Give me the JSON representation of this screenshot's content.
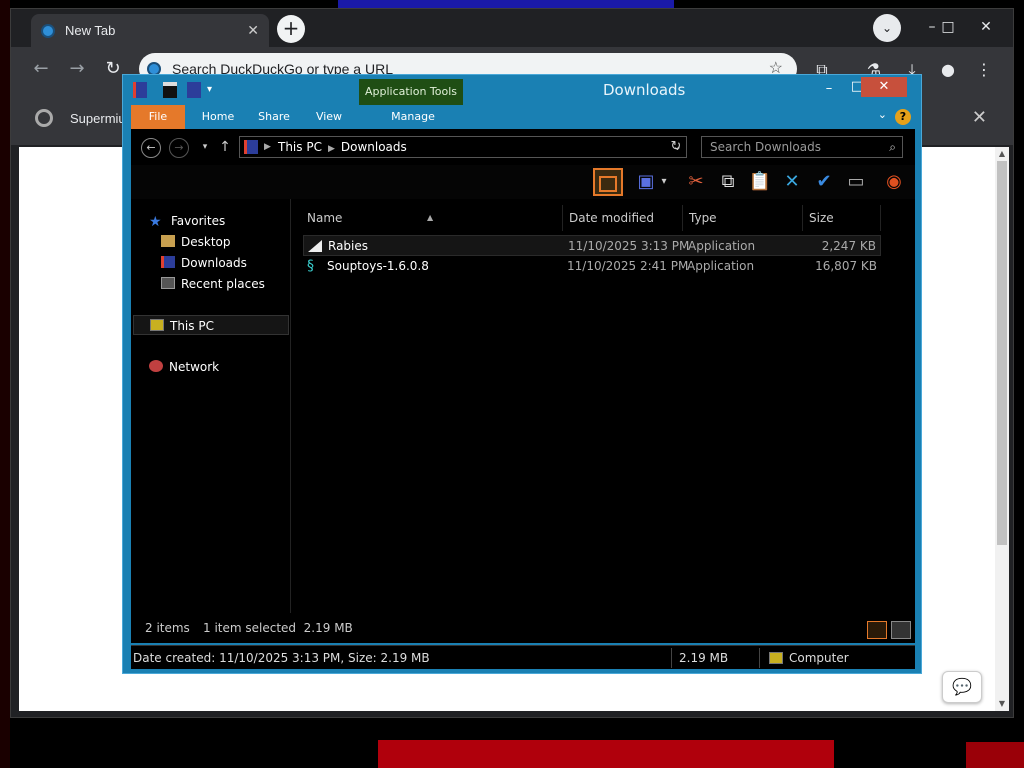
{
  "browser": {
    "tab_title": "New Tab",
    "new_tab_glyph": "+",
    "omnibox_placeholder": "Search DuckDuckGo or type a URL",
    "bookmark_text": "Supermiu"
  },
  "explorer": {
    "context_tab": "Application Tools",
    "title": "Downloads",
    "ribbon_tabs": [
      "File",
      "Home",
      "Share",
      "View",
      "Manage"
    ],
    "breadcrumb": [
      "This PC",
      "Downloads"
    ],
    "search_placeholder": "Search Downloads",
    "nav": {
      "favorites": "Favorites",
      "desktop": "Desktop",
      "downloads": "Downloads",
      "recent": "Recent places",
      "thispc": "This PC",
      "network": "Network"
    },
    "columns": [
      "Name",
      "Date modified",
      "Type",
      "Size"
    ],
    "files": [
      {
        "name": "Rabies",
        "date": "11/10/2025 3:13 PM",
        "type": "Application",
        "size": "2,247 KB"
      },
      {
        "name": "Souptoys-1.6.0.8",
        "date": "11/10/2025 2:41 PM",
        "type": "Application",
        "size": "16,807 KB"
      }
    ],
    "status": {
      "items": "2 items",
      "selected": "1 item selected  2.19 MB"
    },
    "details": {
      "info": "Date created: 11/10/2025 3:13 PM, Size: 2.19 MB",
      "size": "2.19 MB",
      "location": "Computer"
    }
  },
  "colors": {
    "explorer_frame": "#1a80b3",
    "file_tab": "#e5792a",
    "close_button": "#c7503c",
    "context_tab_bg": "#1f4e14"
  }
}
